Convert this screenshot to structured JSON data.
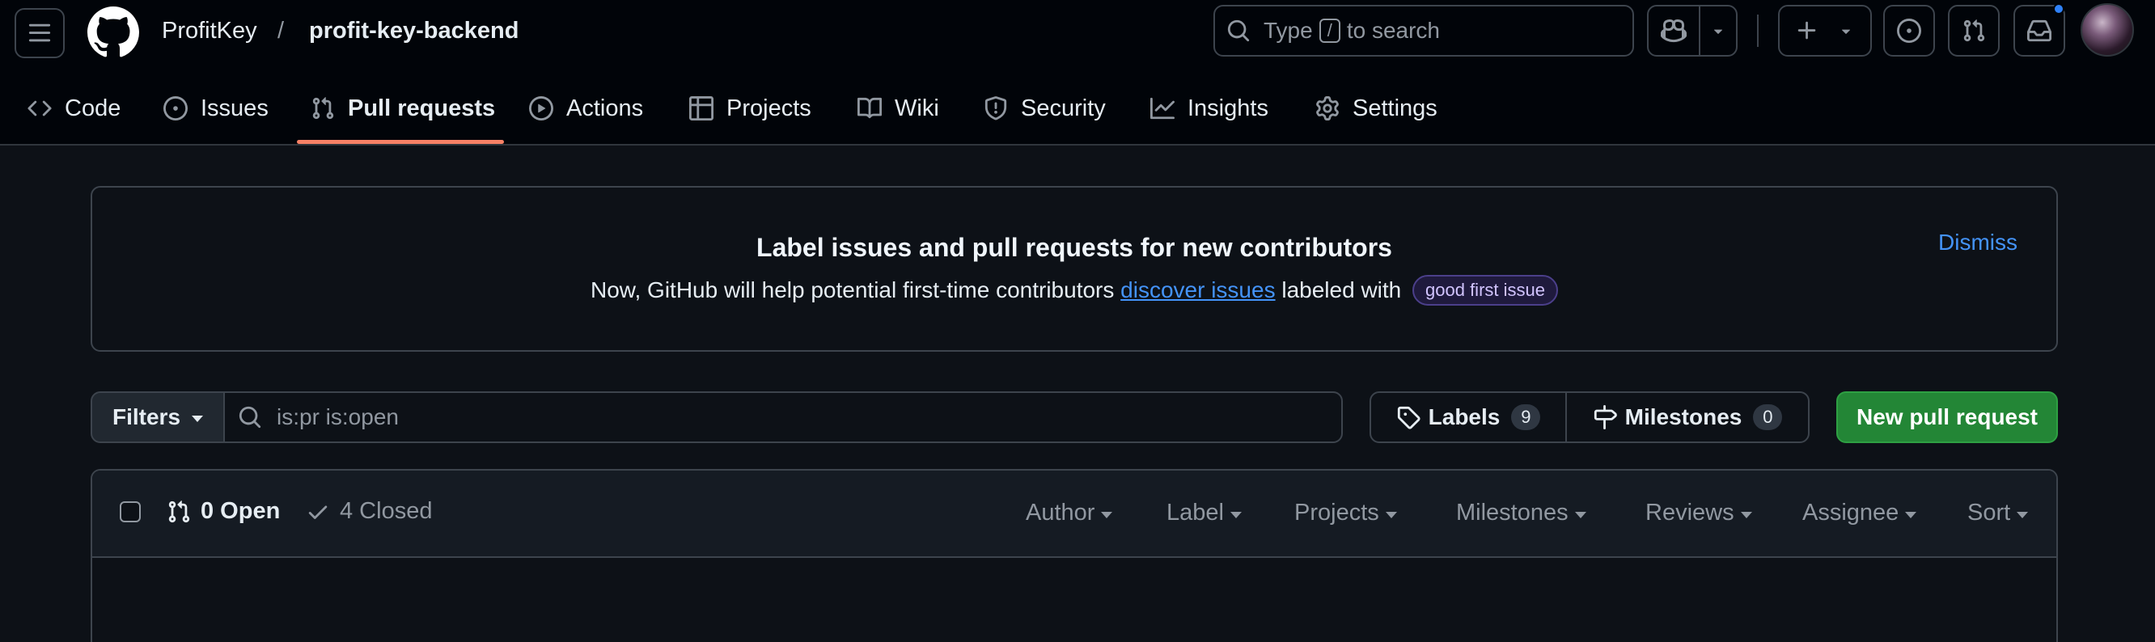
{
  "header": {
    "owner": "ProfitKey",
    "separator": "/",
    "repo": "profit-key-backend",
    "search": {
      "prefix": "Type",
      "key": "/",
      "suffix": "to search"
    },
    "icons": [
      "hamburger-icon",
      "github-mark-icon",
      "search-icon",
      "copilot-icon",
      "plus-icon",
      "issues-icon",
      "pull-request-icon",
      "inbox-icon"
    ],
    "notification_dot_color": "#2f81f7"
  },
  "nav": {
    "tabs": [
      {
        "label": "Code",
        "icon": "code-icon"
      },
      {
        "label": "Issues",
        "icon": "issue-opened-icon"
      },
      {
        "label": "Pull requests",
        "icon": "git-pull-request-icon",
        "active": true
      },
      {
        "label": "Actions",
        "icon": "play-icon"
      },
      {
        "label": "Projects",
        "icon": "table-icon"
      },
      {
        "label": "Wiki",
        "icon": "book-icon"
      },
      {
        "label": "Security",
        "icon": "shield-icon"
      },
      {
        "label": "Insights",
        "icon": "graph-icon"
      },
      {
        "label": "Settings",
        "icon": "gear-icon"
      }
    ],
    "active_underline_color": "#f78166"
  },
  "banner": {
    "title": "Label issues and pull requests for new contributors",
    "text_before": "Now, GitHub will help potential first-time contributors",
    "link": "discover issues",
    "text_after": "labeled with",
    "label": "good first issue",
    "dismiss": "Dismiss"
  },
  "filterbar": {
    "filters_label": "Filters",
    "search_value": "is:pr is:open",
    "labels_label": "Labels",
    "labels_count": "9",
    "milestones_label": "Milestones",
    "milestones_count": "0",
    "new_pr_label": "New pull request",
    "new_pr_color": "#238636"
  },
  "list": {
    "open_label": "0 Open",
    "closed_label": "4 Closed",
    "sort_options": [
      "Author",
      "Label",
      "Projects",
      "Milestones",
      "Reviews",
      "Assignee",
      "Sort"
    ]
  }
}
